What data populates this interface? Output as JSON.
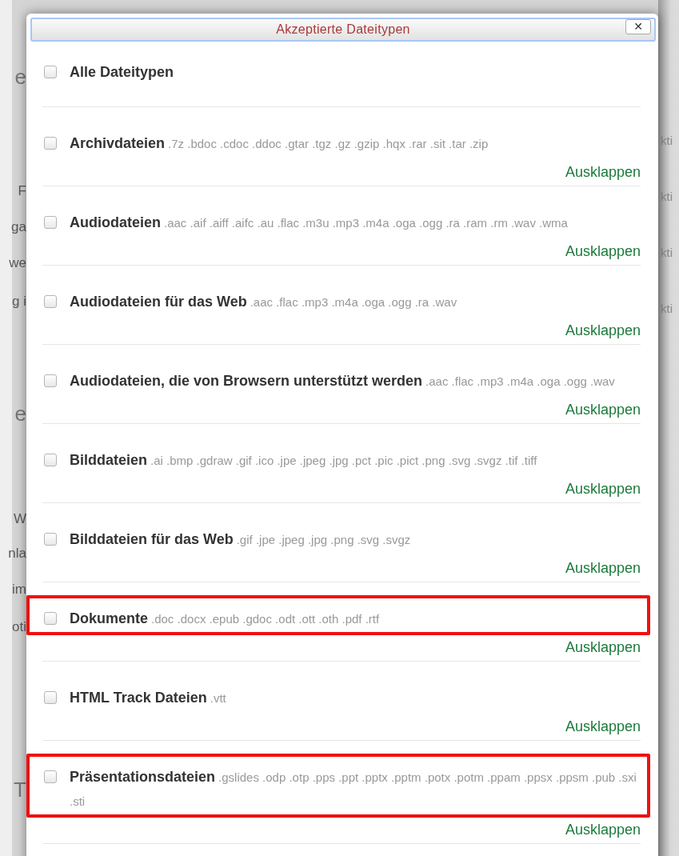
{
  "background_page": {
    "left_fragments": [
      "e",
      "F",
      "ga",
      "we",
      "g i",
      "e",
      "W",
      "nla",
      "im",
      "oti",
      "T"
    ],
    "right_fragments": [
      "kti",
      "kti",
      "kti",
      "kti"
    ]
  },
  "dialog": {
    "title": "Akzeptierte Dateitypen",
    "close_label": "✕",
    "items": [
      {
        "name": "Alle Dateitypen",
        "checked": false,
        "highlighted": false
      },
      {
        "name": "Archivdateien",
        "extensions": ".7z .bdoc .cdoc .ddoc .gtar .tgz .gz .gzip .hqx .rar .sit .tar .zip",
        "checked": false,
        "expand_label": "Ausklappen",
        "highlighted": false
      },
      {
        "name": "Audiodateien",
        "extensions": ".aac .aif .aiff .aifc .au .flac .m3u .mp3 .m4a .oga .ogg .ra .ram .rm .wav .wma",
        "checked": false,
        "expand_label": "Ausklappen",
        "highlighted": false
      },
      {
        "name": "Audiodateien für das Web",
        "extensions": ".aac .flac .mp3 .m4a .oga .ogg .ra .wav",
        "checked": false,
        "expand_label": "Ausklappen",
        "highlighted": false
      },
      {
        "name": "Audiodateien, die von Browsern unterstützt werden",
        "extensions": ".aac .flac .mp3 .m4a .oga .ogg .wav",
        "checked": false,
        "expand_label": "Ausklappen",
        "highlighted": false
      },
      {
        "name": "Bilddateien",
        "extensions": ".ai .bmp .gdraw .gif .ico .jpe .jpeg .jpg .pct .pic .pict .png .svg .svgz .tif .tiff",
        "checked": false,
        "expand_label": "Ausklappen",
        "highlighted": false
      },
      {
        "name": "Bilddateien für das Web",
        "extensions": ".gif .jpe .jpeg .jpg .png .svg .svgz",
        "checked": false,
        "expand_label": "Ausklappen",
        "highlighted": false
      },
      {
        "name": "Dokumente",
        "extensions": ".doc .docx .epub .gdoc .odt .ott .oth .pdf .rtf",
        "checked": false,
        "expand_label": "Ausklappen",
        "highlighted": true
      },
      {
        "name": "HTML Track Dateien",
        "extensions": ".vtt",
        "checked": false,
        "expand_label": "Ausklappen",
        "highlighted": false
      },
      {
        "name": "Präsentationsdateien",
        "extensions": ".gslides .odp .otp .pps .ppt .pptx .pptm .potx .potm .ppam .ppsx .ppsm .pub .sxi .sti",
        "checked": false,
        "expand_label": "Ausklappen",
        "highlighted": true
      }
    ]
  }
}
